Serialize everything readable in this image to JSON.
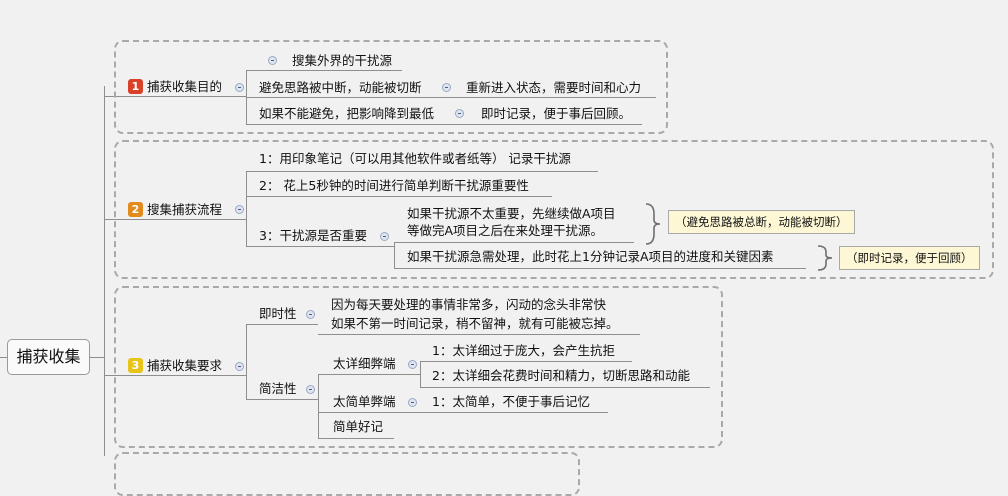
{
  "root": {
    "label": "捕获收集"
  },
  "branches": [
    {
      "badge": "1",
      "badge_color": "#d9412b",
      "label": "捕获收集目的",
      "items": [
        {
          "label": "搜集外界的干扰源"
        },
        {
          "label": "避免思路被中断，动能被切断",
          "child": "重新进入状态，需要时间和心力"
        },
        {
          "label": "如果不能避免，把影响降到最低",
          "child": "即时记录，便于事后回顾。"
        }
      ]
    },
    {
      "badge": "2",
      "badge_color": "#e38a1c",
      "label": "搜集捕获流程",
      "items": [
        {
          "label": "1：用印象笔记（可以用其他软件或者纸等） 记录干扰源"
        },
        {
          "label": "2： 花上5秒钟的时间进行简单判断干扰源重要性"
        },
        {
          "label": "3：干扰源是否重要",
          "children": [
            {
              "lines": [
                "如果干扰源不太重要，先继续做A项目",
                "等做完A项目之后在来处理干扰源。"
              ],
              "note": "（避免思路被总断，动能被切断）"
            },
            {
              "lines": [
                "如果干扰源急需处理，此时花上1分钟记录A项目的进度和关键因素"
              ],
              "note": "（即时记录，便于回顾）"
            }
          ]
        }
      ]
    },
    {
      "badge": "3",
      "badge_color": "#e8c41a",
      "label": "捕获收集要求",
      "items": [
        {
          "label": "即时性",
          "lines": [
            "因为每天要处理的事情非常多，闪动的念头非常快",
            "如果不第一时间记录，稍不留神，就有可能被忘掉。"
          ]
        },
        {
          "label": "简洁性",
          "children": [
            {
              "label": "太详细弊端",
              "subs": [
                "1：太详细过于庞大，会产生抗拒",
                "2：太详细会花费时间和精力，切断思路和动能"
              ]
            },
            {
              "label": "太简单弊端",
              "subs": [
                "1：太简单，不便于事后记忆"
              ]
            },
            {
              "label": "简单好记"
            }
          ]
        }
      ]
    }
  ]
}
